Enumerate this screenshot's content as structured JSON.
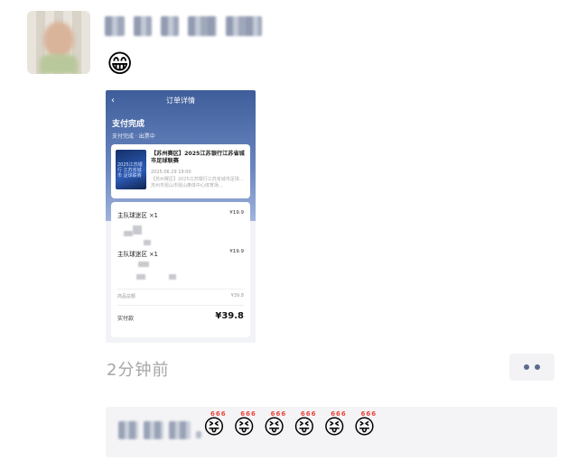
{
  "moment": {
    "time_ago": "2分钟前",
    "post_emoji": "😁"
  },
  "screenshot": {
    "nav_title": "订单详情",
    "back_icon": "‹",
    "status_title": "支付完成",
    "status_sub": "支付完成 · 出票中",
    "event": {
      "thumb_text": "2025江苏银行 江苏省城市 足球联赛",
      "title": "【苏州赛区】2025江苏银行江苏省城市足球联赛",
      "date": "2025.06.29 19:00",
      "desc": "【苏州赛区】2025江苏银行江苏省城市足球…  苏州市昆山市昆山奥体中心体育场…"
    },
    "items": [
      {
        "name": "主队球迷区 ×1",
        "price": "¥19.9"
      },
      {
        "name": "主队球迷区 ×1",
        "price": "¥19.9"
      }
    ],
    "subtotal_label": "商品总额",
    "subtotal_value": "¥39.8",
    "pay_label": "实付款",
    "pay_value": "¥39.8"
  },
  "comment": {
    "emoji": "😝",
    "badge": "666",
    "count": 6
  }
}
